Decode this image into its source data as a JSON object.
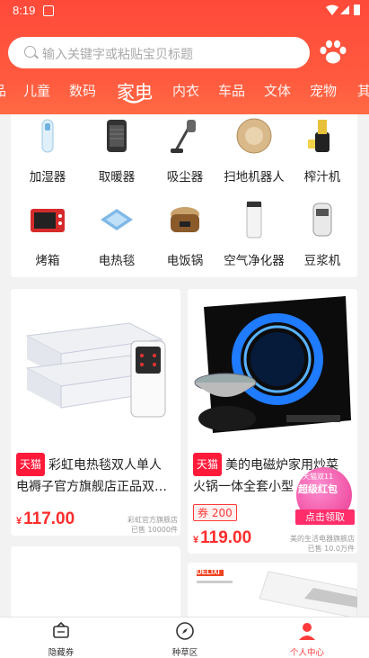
{
  "status_bar": {
    "time": "8:19"
  },
  "search": {
    "placeholder": "输入关键字或粘贴宝贝标题"
  },
  "tabs": {
    "items": [
      "品",
      "儿童",
      "数码",
      "家电",
      "内衣",
      "车品",
      "文体",
      "宠物",
      "其"
    ],
    "active": "家电"
  },
  "categories": [
    {
      "label": "加湿器",
      "icon": "humidifier-icon"
    },
    {
      "label": "取暖器",
      "icon": "heater-icon"
    },
    {
      "label": "吸尘器",
      "icon": "vacuum-icon"
    },
    {
      "label": "扫地机器人",
      "icon": "robot-vacuum-icon"
    },
    {
      "label": "榨汁机",
      "icon": "juicer-icon"
    },
    {
      "label": "烤箱",
      "icon": "oven-icon"
    },
    {
      "label": "电热毯",
      "icon": "electric-blanket-icon"
    },
    {
      "label": "电饭锅",
      "icon": "rice-cooker-icon"
    },
    {
      "label": "空气净化器",
      "icon": "air-purifier-icon"
    },
    {
      "label": "豆浆机",
      "icon": "soymilk-maker-icon"
    }
  ],
  "products": [
    {
      "badge": "天猫",
      "title_line1": "彩虹电热毯双人单人",
      "title_line2": "电褥子官方旗舰店正品双…",
      "price": "117.00",
      "currency": "¥",
      "shop": "彩虹官方旗舰店",
      "sold": "已售 10000件"
    },
    {
      "badge": "天猫",
      "title_line1": "美的电磁炉家用炒菜",
      "title_line2": "火锅一体全套小型",
      "coupon": "券 200",
      "price": "119.00",
      "currency": "¥",
      "shop": "美的生活电器旗舰店",
      "sold": "已售 10.0万件"
    }
  ],
  "promo": {
    "line1": "天猫双11",
    "line2": "超级红包",
    "button": "点击领取"
  },
  "bottom_nav": [
    {
      "label": "隐藏券",
      "icon": "coupon-icon"
    },
    {
      "label": "种草区",
      "icon": "compass-icon"
    },
    {
      "label": "个人中心",
      "icon": "person-icon",
      "active": true
    }
  ],
  "product3_brand": "DELIXI"
}
